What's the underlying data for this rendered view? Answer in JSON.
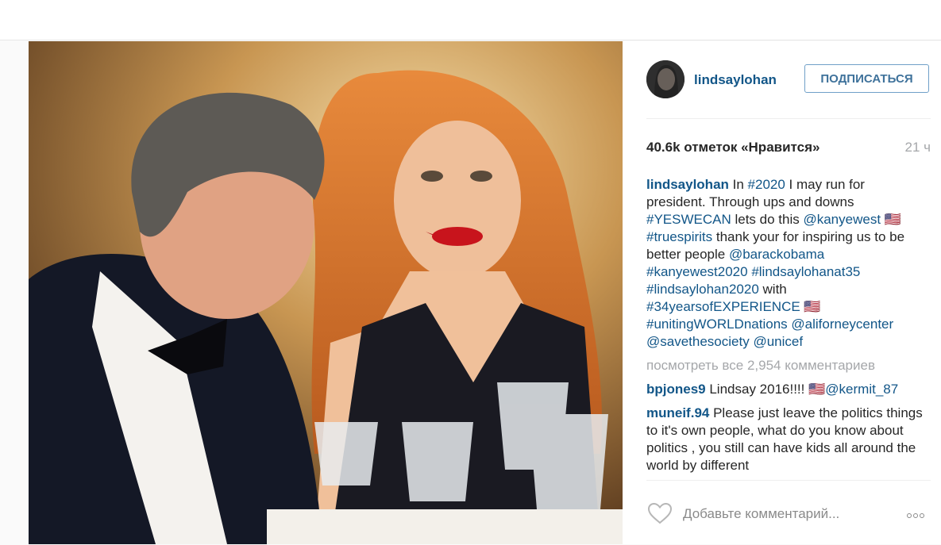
{
  "post": {
    "username": "lindsaylohan",
    "follow_label": "ПОДПИСАТЬСЯ",
    "likes_text": "40.6k отметок «Нравится»",
    "time_text": "21 ч",
    "caption": {
      "user": "lindsaylohan",
      "segments": [
        {
          "t": " In "
        },
        {
          "t": "#2020",
          "tag": true
        },
        {
          "t": " I may run for president. Through ups and downs "
        },
        {
          "t": "#YESWECAN",
          "tag": true
        },
        {
          "t": " lets do this "
        },
        {
          "t": "@kanyewest",
          "tag": true
        },
        {
          "t": " 🇺🇸 "
        },
        {
          "t": "#truespirits",
          "tag": true
        },
        {
          "t": " thank your for inspiring us to be better people "
        },
        {
          "t": "@barackobama",
          "tag": true
        },
        {
          "t": " "
        },
        {
          "t": "#kanyewest2020",
          "tag": true
        },
        {
          "t": " "
        },
        {
          "t": "#lindsaylohanat35",
          "tag": true
        },
        {
          "t": " "
        },
        {
          "t": "#lindsaylohan2020",
          "tag": true
        },
        {
          "t": " with "
        },
        {
          "t": "#34yearsofEXPERIENCE",
          "tag": true
        },
        {
          "t": " 🇺🇸 "
        },
        {
          "t": "#unitingWORLDnations",
          "tag": true
        },
        {
          "t": " "
        },
        {
          "t": "@aliforneycenter",
          "tag": true
        },
        {
          "t": " "
        },
        {
          "t": "@savethesociety",
          "tag": true
        },
        {
          "t": " "
        },
        {
          "t": "@unicef",
          "tag": true
        }
      ]
    },
    "view_all_text": "посмотреть все 2,954 комментариев",
    "comments": [
      {
        "user": "bpjones9",
        "segments": [
          {
            "t": " Lindsay 2016!!!! 🇺🇸"
          },
          {
            "t": "@kermit_87",
            "tag": true
          }
        ]
      },
      {
        "user": "muneif.94",
        "segments": [
          {
            "t": " Please just leave the politics things to it's own people, what do you know about politics , you still can have kids all around the world by different"
          }
        ]
      }
    ],
    "add_comment_placeholder": "Добавьте комментарий...",
    "icons": {
      "heart": "heart-outline-icon",
      "more": "more-options-icon"
    }
  },
  "colors": {
    "link": "#125688",
    "follow_text": "#3f729b",
    "muted": "#a5a7aa",
    "border": "#efefef"
  }
}
